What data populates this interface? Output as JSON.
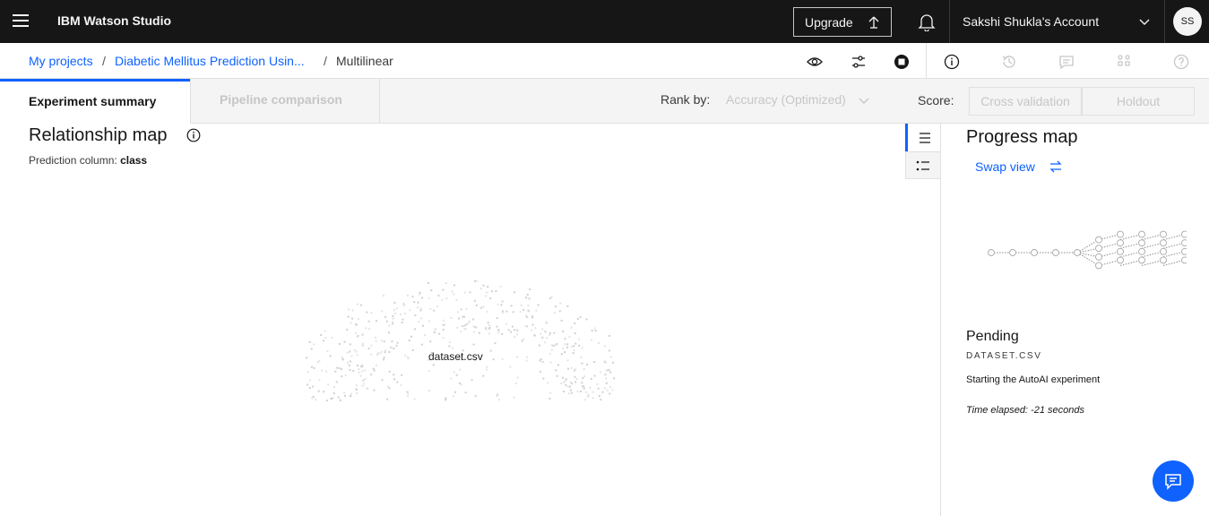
{
  "header": {
    "product_name": "IBM Watson Studio",
    "upgrade_label": "Upgrade",
    "account_name": "Sakshi Shukla's Account",
    "avatar_initials": "SS"
  },
  "breadcrumb": {
    "my_projects": "My projects",
    "project": "Diabetic Mellitus Prediction Usin...",
    "separator": "/",
    "current": "Multilinear"
  },
  "tabs": {
    "active": "Experiment summary",
    "disabled": "Pipeline comparison"
  },
  "toolbar": {
    "rank_label": "Rank by:",
    "rank_value": "Accuracy (Optimized)",
    "score_label": "Score:",
    "cross_validation": "Cross validation",
    "holdout": "Holdout"
  },
  "relationship_map": {
    "title": "Relationship map",
    "prediction_label": "Prediction column:",
    "prediction_value": "class",
    "dataset_label": "dataset.csv"
  },
  "progress_map": {
    "title": "Progress map",
    "swap_view": "Swap view",
    "status": "Pending",
    "dataset": "DATASET.CSV",
    "message": "Starting the AutoAI experiment",
    "elapsed": "Time elapsed: -21 seconds"
  },
  "colors": {
    "accent": "#0f62fe",
    "topbar": "#161616"
  }
}
